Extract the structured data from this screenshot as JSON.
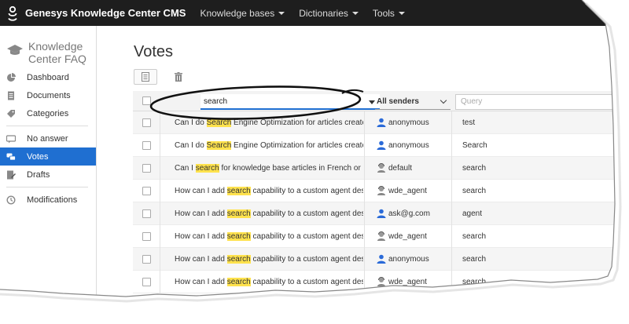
{
  "topbar": {
    "brand": "Genesys Knowledge Center CMS",
    "menus": [
      "Knowledge bases",
      "Dictionaries",
      "Tools"
    ]
  },
  "sidebar": {
    "title_line1": "Knowledge",
    "title_line2": "Center FAQ",
    "items": [
      {
        "label": "Dashboard",
        "icon": "pie-chart-icon"
      },
      {
        "label": "Documents",
        "icon": "document-icon"
      },
      {
        "label": "Categories",
        "icon": "tag-icon"
      },
      {
        "label": "No answer",
        "icon": "chat-icon"
      },
      {
        "label": "Votes",
        "icon": "votes-icon",
        "active": true
      },
      {
        "label": "Drafts",
        "icon": "drafts-icon"
      },
      {
        "label": "Modifications",
        "icon": "history-icon"
      }
    ]
  },
  "main": {
    "title": "Votes",
    "filters": {
      "search_value": "search",
      "sender_value": "All senders",
      "query_placeholder": "Query"
    },
    "rows": [
      {
        "pre": "Can I do ",
        "hl": "Search",
        "post": " Engine Optimization for articles created in ...",
        "sender": "anonymous",
        "sender_type": "user",
        "query": "test"
      },
      {
        "pre": "Can I do ",
        "hl": "Search",
        "post": " Engine Optimization for articles created in ...",
        "sender": "anonymous",
        "sender_type": "user",
        "query": "Search"
      },
      {
        "pre": "Can I ",
        "hl": "search",
        "post": " for knowledge base articles in French or other...",
        "sender": "default",
        "sender_type": "agent",
        "query": "search"
      },
      {
        "pre": "How can I add ",
        "hl": "search",
        "post": " capability to a custom agent desktop?",
        "sender": "wde_agent",
        "sender_type": "agent",
        "query": "search"
      },
      {
        "pre": "How can I add ",
        "hl": "search",
        "post": " capability to a custom agent desktop?",
        "sender": "ask@g.com",
        "sender_type": "user",
        "query": "agent"
      },
      {
        "pre": "How can I add ",
        "hl": "search",
        "post": " capability to a custom agent desktop?",
        "sender": "wde_agent",
        "sender_type": "agent",
        "query": "search"
      },
      {
        "pre": "How can I add ",
        "hl": "search",
        "post": " capability to a custom agent desktop?",
        "sender": "anonymous",
        "sender_type": "user",
        "query": "search"
      },
      {
        "pre": "How can I add ",
        "hl": "search",
        "post": " capability to a custom agent desktop?",
        "sender": "wde_agent",
        "sender_type": "agent",
        "query": "search"
      }
    ]
  },
  "colors": {
    "topbar_bg": "#1e1e1e",
    "active_blue": "#1f6fd1",
    "highlight_yellow": "#ffe24d"
  }
}
